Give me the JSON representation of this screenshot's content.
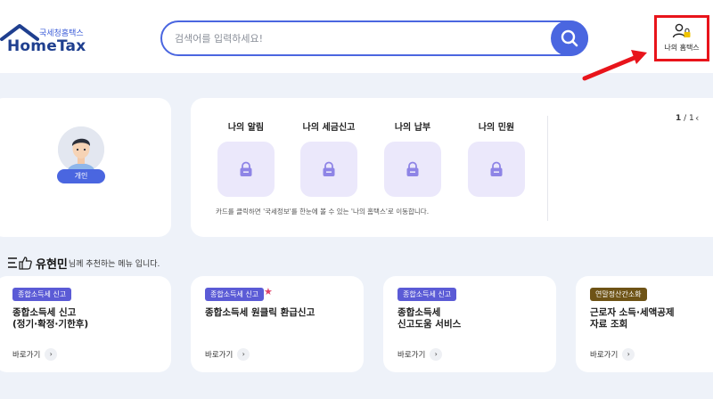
{
  "header": {
    "logo_sub": "국세청홈택스",
    "logo_main": "HomeTax",
    "search_placeholder": "검색어를 입력하세요!",
    "my_hometax_label": "나의 홈택스"
  },
  "profile": {
    "badge": "개인"
  },
  "my_hometax": {
    "items": [
      {
        "label": "나의 알림",
        "icon": "lock-icon"
      },
      {
        "label": "나의 세금신고",
        "icon": "lock-icon"
      },
      {
        "label": "나의 납부",
        "icon": "lock-icon"
      },
      {
        "label": "나의 민원",
        "icon": "lock-icon"
      }
    ],
    "note": "카드를 클릭하면 '국세정보'를 한눈에 볼 수 있는 '나의 홈택스'로 이동합니다.",
    "pager_current": "1",
    "pager_sep": " / ",
    "pager_total": "1"
  },
  "recommend": {
    "user_name": "유현민",
    "suffix": "님께 추천하는 메뉴 입니다.",
    "go_label": "바로가기",
    "cards": [
      {
        "tag": "종합소득세 신고",
        "line1": "종합소득세 신고",
        "line2": "(정기·확정·기한후)",
        "tag_color": "#5b5bd6"
      },
      {
        "tag": "종합소득세 신고",
        "line1": "종합소득세 원클릭 환급신고",
        "line2": "",
        "tag_color": "#5b5bd6"
      },
      {
        "tag": "종합소득세 신고",
        "line1": "종합소득세",
        "line2": "신고도움 서비스",
        "tag_color": "#5b5bd6"
      },
      {
        "tag": "연말정산간소화",
        "line1": "근로자 소득·세액공제",
        "line2": "자료 조회",
        "tag_color": "#6e5316"
      }
    ]
  },
  "colors": {
    "accent": "#4a66e0",
    "highlight_box": "#e8141b",
    "background": "#eef2f9"
  }
}
